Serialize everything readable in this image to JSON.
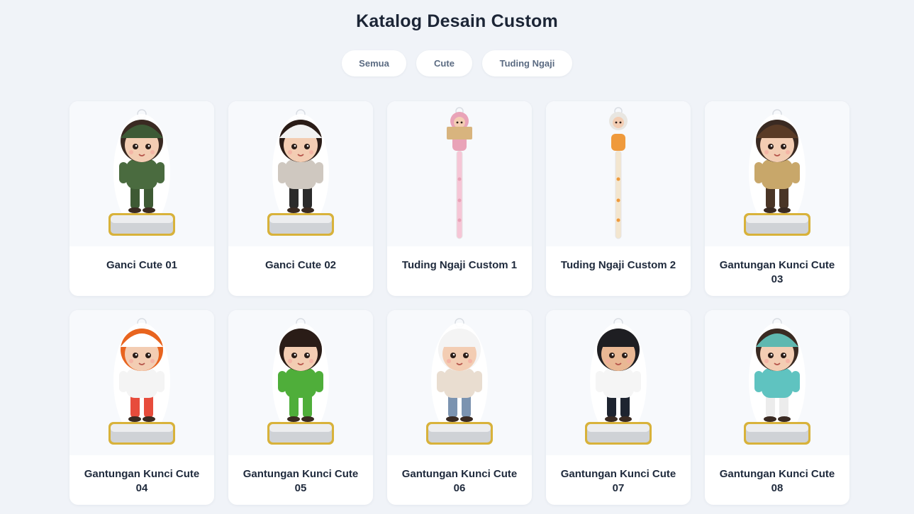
{
  "page": {
    "title": "Katalog Desain Custom"
  },
  "filters": [
    {
      "label": "Semua",
      "active": true
    },
    {
      "label": "Cute",
      "active": false
    },
    {
      "label": "Tuding Ngaji",
      "active": false
    }
  ],
  "products": [
    {
      "name": "Ganci Cute 01",
      "figure": "soldier-keychain-icon",
      "kind": "keychain",
      "hat": "#3d5a36",
      "top": "#4a6b3f",
      "bottom": "#3e5a34",
      "skin": "#f3cdb3",
      "hair": "#3a2a22"
    },
    {
      "name": "Ganci Cute 02",
      "figure": "police-girl-keychain-icon",
      "kind": "keychain",
      "hat": "#f2f2f2",
      "top": "#cfc8c0",
      "bottom": "#2b2b2b",
      "skin": "#f3cdb3",
      "hair": "#2a1c17"
    },
    {
      "name": "Tuding Ngaji Custom 1",
      "figure": "pink-hijab-pointer-icon",
      "kind": "pointer",
      "hat": "#e9a3b8",
      "top": "#e9a3b8",
      "bottom": "#d98aa2",
      "skin": "#f3cdb3",
      "hair": "#e9a3b8",
      "stick": "#f6c6d6"
    },
    {
      "name": "Tuding Ngaji Custom 2",
      "figure": "green-hijab-pointer-icon",
      "kind": "pointer",
      "hat": "#e8e6e1",
      "top": "#ef9a3c",
      "bottom": "#57b88a",
      "skin": "#f3cdb3",
      "hair": "#e8e6e1",
      "stick": "#f3e6cf"
    },
    {
      "name": "Gantungan Kunci Cute 03",
      "figure": "police-officer-keychain-icon",
      "kind": "keychain",
      "hat": "#5a3b26",
      "top": "#c8a76a",
      "bottom": "#4a3526",
      "skin": "#f3cdb3",
      "hair": "#3a2a22"
    },
    {
      "name": "Gantungan Kunci Cute 04",
      "figure": "nurse-keychain-icon",
      "kind": "keychain",
      "hat": "#ffffff",
      "top": "#f4f4f4",
      "bottom": "#e74c3c",
      "skin": "#f3cdb3",
      "hair": "#e8641f"
    },
    {
      "name": "Gantungan Kunci Cute 05",
      "figure": "skater-girl-keychain-icon",
      "kind": "keychain",
      "hat": "#2a1c17",
      "top": "#4fae3a",
      "bottom": "#4fae3a",
      "skin": "#f3cdb3",
      "hair": "#2a1c17"
    },
    {
      "name": "Gantungan Kunci Cute 06",
      "figure": "helmet-girl-keychain-icon",
      "kind": "keychain",
      "hat": "#f4f4f4",
      "top": "#e9ddd0",
      "bottom": "#7b93b0",
      "skin": "#f3cdb3",
      "hair": "#f4f4f4"
    },
    {
      "name": "Gantungan Kunci Cute 07",
      "figure": "pilot-boy-keychain-icon",
      "kind": "keychain",
      "hat": "#1e1e22",
      "top": "#f5f5f5",
      "bottom": "#1e2430",
      "skin": "#e9b894",
      "hair": "#1e1e22"
    },
    {
      "name": "Gantungan Kunci Cute 08",
      "figure": "headphone-girl-keychain-icon",
      "kind": "keychain",
      "hat": "#5fb8b0",
      "top": "#5fc3c0",
      "bottom": "#ececec",
      "skin": "#f3cdb3",
      "hair": "#3a2a22"
    }
  ],
  "theme": {
    "accent": "#2868e8",
    "plate_gold": "#d8b23a"
  }
}
